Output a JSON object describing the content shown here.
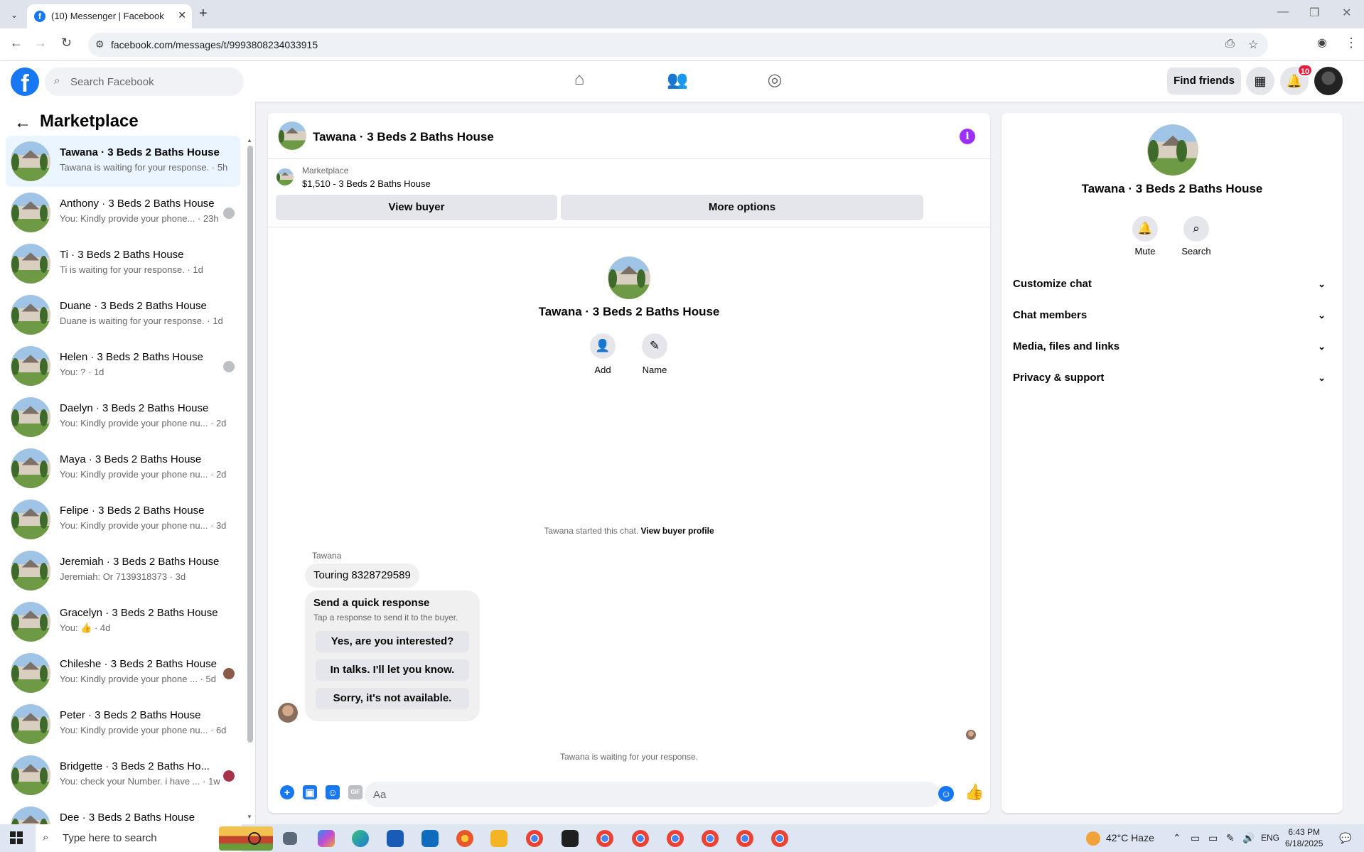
{
  "browser": {
    "tab_title": "(10) Messenger | Facebook",
    "url": "facebook.com/messages/t/9993808234033915"
  },
  "fb": {
    "search_placeholder": "Search Facebook",
    "find_friends": "Find friends",
    "notif_count": "10"
  },
  "sidebar": {
    "title": "Marketplace",
    "conversations": [
      {
        "name": "Tawana · 3 Beds 2 Baths House",
        "preview": "Tawana is waiting for your response. · 5h"
      },
      {
        "name": "Anthony · 3 Beds 2 Baths House",
        "preview": "You: Kindly provide your phone... · 23h"
      },
      {
        "name": "Ti · 3 Beds 2 Baths House",
        "preview": "Ti is waiting for your response. · 1d"
      },
      {
        "name": "Duane · 3 Beds 2 Baths House",
        "preview": "Duane is waiting for your response. · 1d"
      },
      {
        "name": "Helen · 3 Beds 2 Baths House",
        "preview": "You: ? · 1d"
      },
      {
        "name": "Daelyn · 3 Beds 2 Baths House",
        "preview": "You: Kindly provide your phone nu... · 2d"
      },
      {
        "name": "Maya · 3 Beds 2 Baths House",
        "preview": "You: Kindly provide your phone nu... · 2d"
      },
      {
        "name": "Felipe · 3 Beds 2 Baths House",
        "preview": "You: Kindly provide your phone nu... · 3d"
      },
      {
        "name": "Jeremiah · 3 Beds 2 Baths House",
        "preview": "Jeremiah: Or 7139318373 · 3d"
      },
      {
        "name": "Gracelyn · 3 Beds 2 Baths House",
        "preview": "You: 👍 · 4d"
      },
      {
        "name": "Chileshe · 3 Beds 2 Baths House",
        "preview": "You: Kindly provide your phone ... · 5d"
      },
      {
        "name": "Peter · 3 Beds 2 Baths House",
        "preview": "You: Kindly provide your phone nu... · 6d"
      },
      {
        "name": "Bridgette · 3 Beds 2 Baths Ho...",
        "preview": "You: check your Number. i have ... · 1w"
      },
      {
        "name": "Dee · 3 Beds 2 Baths House",
        "preview": ""
      }
    ]
  },
  "chat": {
    "title": "Tawana · 3 Beds 2 Baths House",
    "marketplace_label": "Marketplace",
    "listing": "$1,510 - 3 Beds 2 Baths House",
    "view_buyer": "View buyer",
    "more_options": "More options",
    "add_label": "Add",
    "name_label": "Name",
    "started_text": "Tawana started this chat.",
    "view_buyer_profile": "View buyer profile",
    "sender_name": "Tawana",
    "message": "Touring 8328729589",
    "quick_title": "Send a quick response",
    "quick_sub": "Tap a response to send it to the buyer.",
    "quick_options": [
      "Yes, are you interested?",
      "In talks. I'll let you know.",
      "Sorry, it's not available."
    ],
    "waiting_text": "Tawana is waiting for your response.",
    "composer_placeholder": "Aa"
  },
  "details": {
    "name": "Tawana · 3 Beds 2 Baths House",
    "mute": "Mute",
    "search": "Search",
    "sections": [
      "Customize chat",
      "Chat members",
      "Media, files and links",
      "Privacy & support"
    ]
  },
  "taskbar": {
    "search_placeholder": "Type here to search",
    "weather": "42°C  Haze",
    "lang": "ENG",
    "time": "6:43 PM",
    "date": "6/18/2025"
  }
}
